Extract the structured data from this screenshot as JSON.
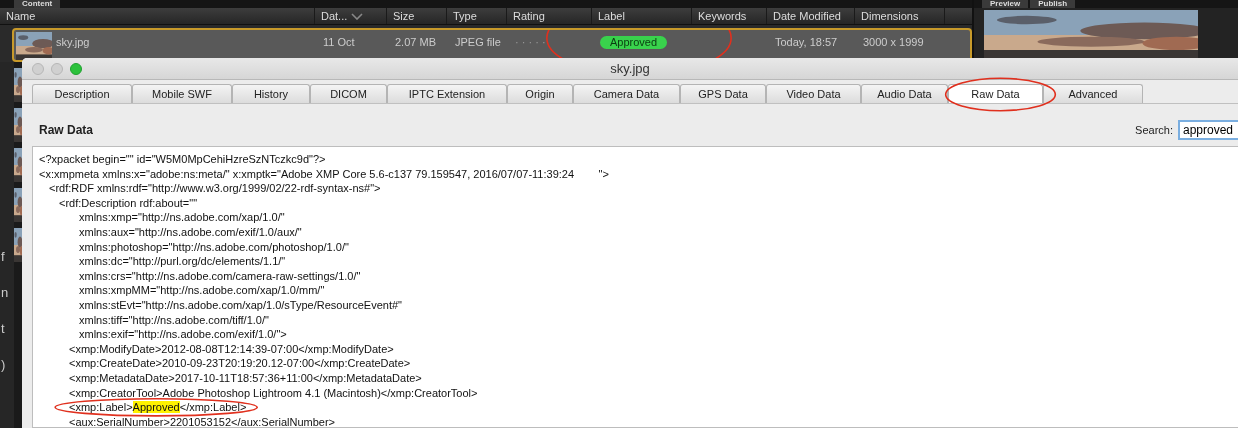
{
  "left_panel_tabs": [
    {
      "label": "Content"
    }
  ],
  "right_panel_tabs": [
    {
      "label": "Preview"
    },
    {
      "label": "Publish"
    }
  ],
  "content": {
    "columns": [
      {
        "label": "Name"
      },
      {
        "label": "Dat...",
        "sorted": true
      },
      {
        "label": "Size"
      },
      {
        "label": "Type"
      },
      {
        "label": "Rating"
      },
      {
        "label": "Label"
      },
      {
        "label": "Keywords"
      },
      {
        "label": "Date Modified"
      },
      {
        "label": "Dimensions"
      }
    ],
    "rows": [
      {
        "name": "sky.jpg",
        "date": "11 Oct",
        "size": "2.07 MB",
        "type": "JPEG file",
        "rating": "· · · · ·",
        "label": "Approved",
        "label_circled": true,
        "date_modified": "Today, 18:57",
        "dimensions": "3000 x 1999",
        "selected": true
      }
    ]
  },
  "left_panel_fragments": [
    "f",
    "n",
    "t",
    ")"
  ],
  "dialog": {
    "title": "sky.jpg",
    "tabs": [
      {
        "label": "Description",
        "selected": false,
        "circled": false
      },
      {
        "label": "Mobile SWF",
        "selected": false,
        "circled": false
      },
      {
        "label": "History",
        "selected": false,
        "circled": false
      },
      {
        "label": "DICOM",
        "selected": false,
        "circled": false
      },
      {
        "label": "IPTC Extension",
        "selected": false,
        "circled": false
      },
      {
        "label": "Origin",
        "selected": false,
        "circled": false
      },
      {
        "label": "Camera Data",
        "selected": false,
        "circled": false
      },
      {
        "label": "GPS Data",
        "selected": false,
        "circled": false
      },
      {
        "label": "Video Data",
        "selected": false,
        "circled": false
      },
      {
        "label": "Audio Data",
        "selected": false,
        "circled": false
      },
      {
        "label": "Raw Data",
        "selected": true,
        "circled": true
      },
      {
        "label": "Advanced",
        "selected": false,
        "circled": false
      }
    ],
    "heading": "Raw Data",
    "search": {
      "label": "Search:",
      "value": "approved"
    },
    "lines": [
      {
        "kind": "element",
        "parts": [
          {
            "text": "<?xpacket begin=\"\" id=\"W5M0MpCehiHzreSzNTczkc9d\"?>"
          }
        ]
      },
      {
        "kind": "element",
        "parts": [
          {
            "text": "<x:xmpmeta xmlns:x=\"adobe:ns:meta/\" x:xmptk=\"Adobe XMP Core 5.6-c137 79.159547, 2016/07/07-11:39:24        \">"
          }
        ],
        "children": [
          {
            "kind": "element",
            "parts": [
              {
                "text": "<rdf:RDF xmlns:rdf=\"http://www.w3.org/1999/02/22-rdf-syntax-ns#\">"
              }
            ],
            "children": [
              {
                "kind": "element",
                "parts": [
                  {
                    "text": "<rdf:Description rdf:about=\"\""
                  }
                ],
                "children": [
                  {
                    "kind": "attribute",
                    "parts": [
                      {
                        "text": "xmlns:xmp=\"http://ns.adobe.com/xap/1.0/\""
                      }
                    ]
                  },
                  {
                    "kind": "attribute",
                    "parts": [
                      {
                        "text": "xmlns:aux=\"http://ns.adobe.com/exif/1.0/aux/\""
                      }
                    ]
                  },
                  {
                    "kind": "attribute",
                    "parts": [
                      {
                        "text": "xmlns:photoshop=\"http://ns.adobe.com/photoshop/1.0/\""
                      }
                    ]
                  },
                  {
                    "kind": "attribute",
                    "parts": [
                      {
                        "text": "xmlns:dc=\"http://purl.org/dc/elements/1.1/\""
                      }
                    ]
                  },
                  {
                    "kind": "attribute",
                    "parts": [
                      {
                        "text": "xmlns:crs=\"http://ns.adobe.com/camera-raw-settings/1.0/\""
                      }
                    ]
                  },
                  {
                    "kind": "attribute",
                    "parts": [
                      {
                        "text": "xmlns:xmpMM=\"http://ns.adobe.com/xap/1.0/mm/\""
                      }
                    ]
                  },
                  {
                    "kind": "attribute",
                    "parts": [
                      {
                        "text": "xmlns:stEvt=\"http://ns.adobe.com/xap/1.0/sType/ResourceEvent#\""
                      }
                    ]
                  },
                  {
                    "kind": "attribute",
                    "parts": [
                      {
                        "text": "xmlns:tiff=\"http://ns.adobe.com/tiff/1.0/\""
                      }
                    ]
                  },
                  {
                    "kind": "attribute",
                    "parts": [
                      {
                        "text": "xmlns:exif=\"http://ns.adobe.com/exif/1.0/\">"
                      }
                    ]
                  },
                  {
                    "kind": "element",
                    "parts": [
                      {
                        "text": "<xmp:ModifyDate>2012-08-08T12:14:39-07:00</xmp:ModifyDate>"
                      }
                    ]
                  },
                  {
                    "kind": "element",
                    "parts": [
                      {
                        "text": "<xmp:CreateDate>2010-09-23T20:19:20.12-07:00</xmp:CreateDate>"
                      }
                    ]
                  },
                  {
                    "kind": "element",
                    "parts": [
                      {
                        "text": "<xmp:MetadataDate>2017-10-11T18:57:36+11:00</xmp:MetadataDate>"
                      }
                    ]
                  },
                  {
                    "kind": "element",
                    "parts": [
                      {
                        "text": "<xmp:CreatorTool>Adobe Photoshop Lightroom 4.1 (Macintosh)</xmp:CreatorTool>"
                      }
                    ]
                  },
                  {
                    "kind": "element",
                    "circled": true,
                    "parts": [
                      {
                        "text": "<xmp:Label>"
                      },
                      {
                        "text": "Approved",
                        "highlighted": true
                      },
                      {
                        "text": "</xmp:Label>"
                      }
                    ]
                  },
                  {
                    "kind": "element",
                    "parts": [
                      {
                        "text": "<aux:SerialNumber>2201053152</aux:SerialNumber>"
                      }
                    ]
                  }
                ]
              }
            ]
          }
        ]
      }
    ]
  }
}
